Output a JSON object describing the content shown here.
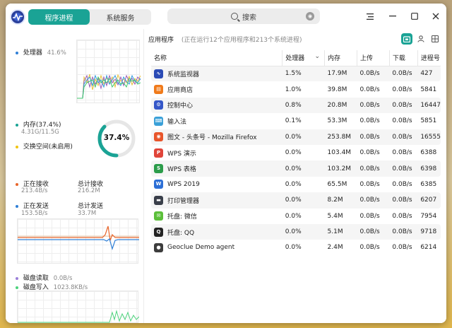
{
  "tabs": [
    {
      "label": "程序进程"
    },
    {
      "label": "系统服务"
    }
  ],
  "search": {
    "label": "搜索"
  },
  "window_controls": [
    "menu-icon",
    "minimize-icon",
    "maximize-icon",
    "close-icon"
  ],
  "cpu": {
    "label": "处理器",
    "value": "41.6%"
  },
  "memory": {
    "label": "内存(37.4%)",
    "used": "4.31G/11.5G",
    "swap_label": "交换空间(未启用)",
    "percent_label": "37.4%",
    "percent": 0.374
  },
  "network": {
    "recv_label": "正在接收",
    "recv_rate": "213.4B/s",
    "recv_total_label": "总计接收",
    "recv_total": "216.2M",
    "send_label": "正在发送",
    "send_rate": "153.5B/s",
    "send_total_label": "总计发送",
    "send_total": "33.7M"
  },
  "disk": {
    "read_label": "磁盘读取",
    "read_rate": "0.0B/s",
    "write_label": "磁盘写入",
    "write_rate": "1023.8KB/s"
  },
  "right": {
    "title": "应用程序",
    "desc": "(正在运行12个应用程序和213个系统进程)"
  },
  "columns": [
    "名称",
    "处理器",
    "内存",
    "上传",
    "下载",
    "进程号"
  ],
  "processes": [
    {
      "name": "系统监视器",
      "cpu": "1.5%",
      "mem": "17.9M",
      "up": "0.0B/s",
      "down": "0.0B/s",
      "pid": "427",
      "icon": "system-monitor-icon",
      "color": "#2b4bb5"
    },
    {
      "name": "应用商店",
      "cpu": "1.0%",
      "mem": "39.8M",
      "up": "0.0B/s",
      "down": "0.0B/s",
      "pid": "5841",
      "icon": "app-store-icon",
      "color": "#f07a1a"
    },
    {
      "name": "控制中心",
      "cpu": "0.8%",
      "mem": "20.8M",
      "up": "0.0B/s",
      "down": "0.0B/s",
      "pid": "16447",
      "icon": "control-center-icon",
      "color": "#3557c8"
    },
    {
      "name": "输入法",
      "cpu": "0.1%",
      "mem": "53.3M",
      "up": "0.0B/s",
      "down": "0.0B/s",
      "pid": "5851",
      "icon": "input-method-icon",
      "color": "#3aa0d8"
    },
    {
      "name": "图文 - 头条号 - Mozilla Firefox",
      "cpu": "0.0%",
      "mem": "253.8M",
      "up": "0.0B/s",
      "down": "0.0B/s",
      "pid": "16555",
      "icon": "firefox-icon",
      "color": "#e8552a"
    },
    {
      "name": "WPS 演示",
      "cpu": "0.0%",
      "mem": "103.4M",
      "up": "0.0B/s",
      "down": "0.0B/s",
      "pid": "6388",
      "icon": "wps-presentation-icon",
      "color": "#e0453a"
    },
    {
      "name": "WPS 表格",
      "cpu": "0.0%",
      "mem": "103.2M",
      "up": "0.0B/s",
      "down": "0.0B/s",
      "pid": "6398",
      "icon": "wps-spreadsheet-icon",
      "color": "#2b9c4a"
    },
    {
      "name": "WPS 2019",
      "cpu": "0.0%",
      "mem": "65.5M",
      "up": "0.0B/s",
      "down": "0.0B/s",
      "pid": "6385",
      "icon": "wps-icon",
      "color": "#2c6fd6"
    },
    {
      "name": "打印管理器",
      "cpu": "0.0%",
      "mem": "8.2M",
      "up": "0.0B/s",
      "down": "0.0B/s",
      "pid": "6207",
      "icon": "printer-icon",
      "color": "#3a3f4a"
    },
    {
      "name": "托盘: 微信",
      "cpu": "0.0%",
      "mem": "5.4M",
      "up": "0.0B/s",
      "down": "0.0B/s",
      "pid": "7954",
      "icon": "wechat-icon",
      "color": "#5cbf3a"
    },
    {
      "name": "托盘: QQ",
      "cpu": "0.0%",
      "mem": "5.1M",
      "up": "0.0B/s",
      "down": "0.0B/s",
      "pid": "9718",
      "icon": "qq-icon",
      "color": "#222222"
    },
    {
      "name": "Geoclue Demo agent",
      "cpu": "0.0%",
      "mem": "2.4M",
      "up": "0.0B/s",
      "down": "0.0B/s",
      "pid": "6214",
      "icon": "location-pin-icon",
      "color": "#3d3d3d"
    }
  ],
  "colors": {
    "accent": "#1aa395",
    "cpu_dot": "#2f7fd6",
    "mem_dot": "#1aa395",
    "swap_dot": "#f1c40f",
    "recv_dot": "#e8652a",
    "send_dot": "#2f7fd6",
    "read_dot": "#9b7fd9",
    "write_dot": "#4cd37c"
  }
}
